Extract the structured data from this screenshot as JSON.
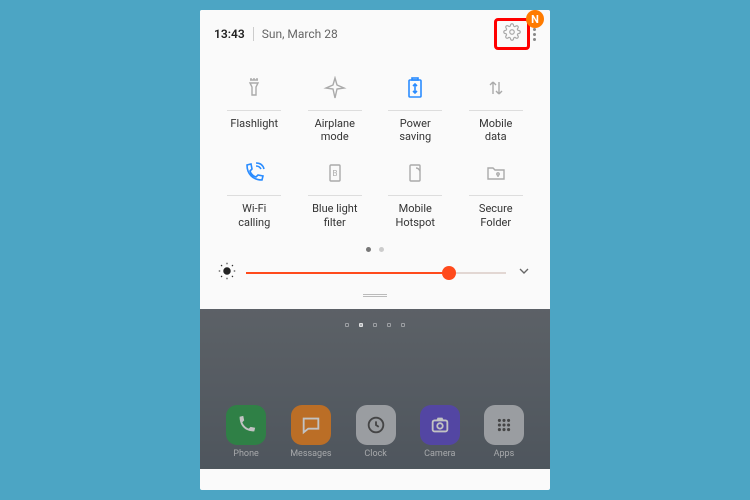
{
  "status": {
    "time": "13:43",
    "date": "Sun, March 28",
    "badge": "N"
  },
  "toggles": [
    {
      "id": "flashlight",
      "label": "Flashlight",
      "active": false
    },
    {
      "id": "airplane",
      "label": "Airplane\nmode",
      "active": false
    },
    {
      "id": "powersave",
      "label": "Power\nsaving",
      "active": true
    },
    {
      "id": "mobiledata",
      "label": "Mobile\ndata",
      "active": false
    },
    {
      "id": "wificall",
      "label": "Wi-Fi\ncalling",
      "active": true
    },
    {
      "id": "bluelight",
      "label": "Blue light\nfilter",
      "active": false
    },
    {
      "id": "hotspot",
      "label": "Mobile\nHotspot",
      "active": false
    },
    {
      "id": "secfolder",
      "label": "Secure\nFolder",
      "active": false
    }
  ],
  "pager": {
    "pages": 2,
    "active": 0
  },
  "brightness": {
    "percent": 78
  },
  "dock": [
    {
      "id": "phone",
      "label": "Phone",
      "bg": "#2fa84f"
    },
    {
      "id": "messages",
      "label": "Messages",
      "bg": "#ff8a1e"
    },
    {
      "id": "clock",
      "label": "Clock",
      "bg": "#c9ccd1"
    },
    {
      "id": "camera",
      "label": "Camera",
      "bg": "#6a55e0"
    },
    {
      "id": "apps",
      "label": "Apps",
      "bg": "#c9ccd1"
    }
  ],
  "colors": {
    "accent": "#ff4a1c",
    "active_toggle": "#2a8cff"
  }
}
